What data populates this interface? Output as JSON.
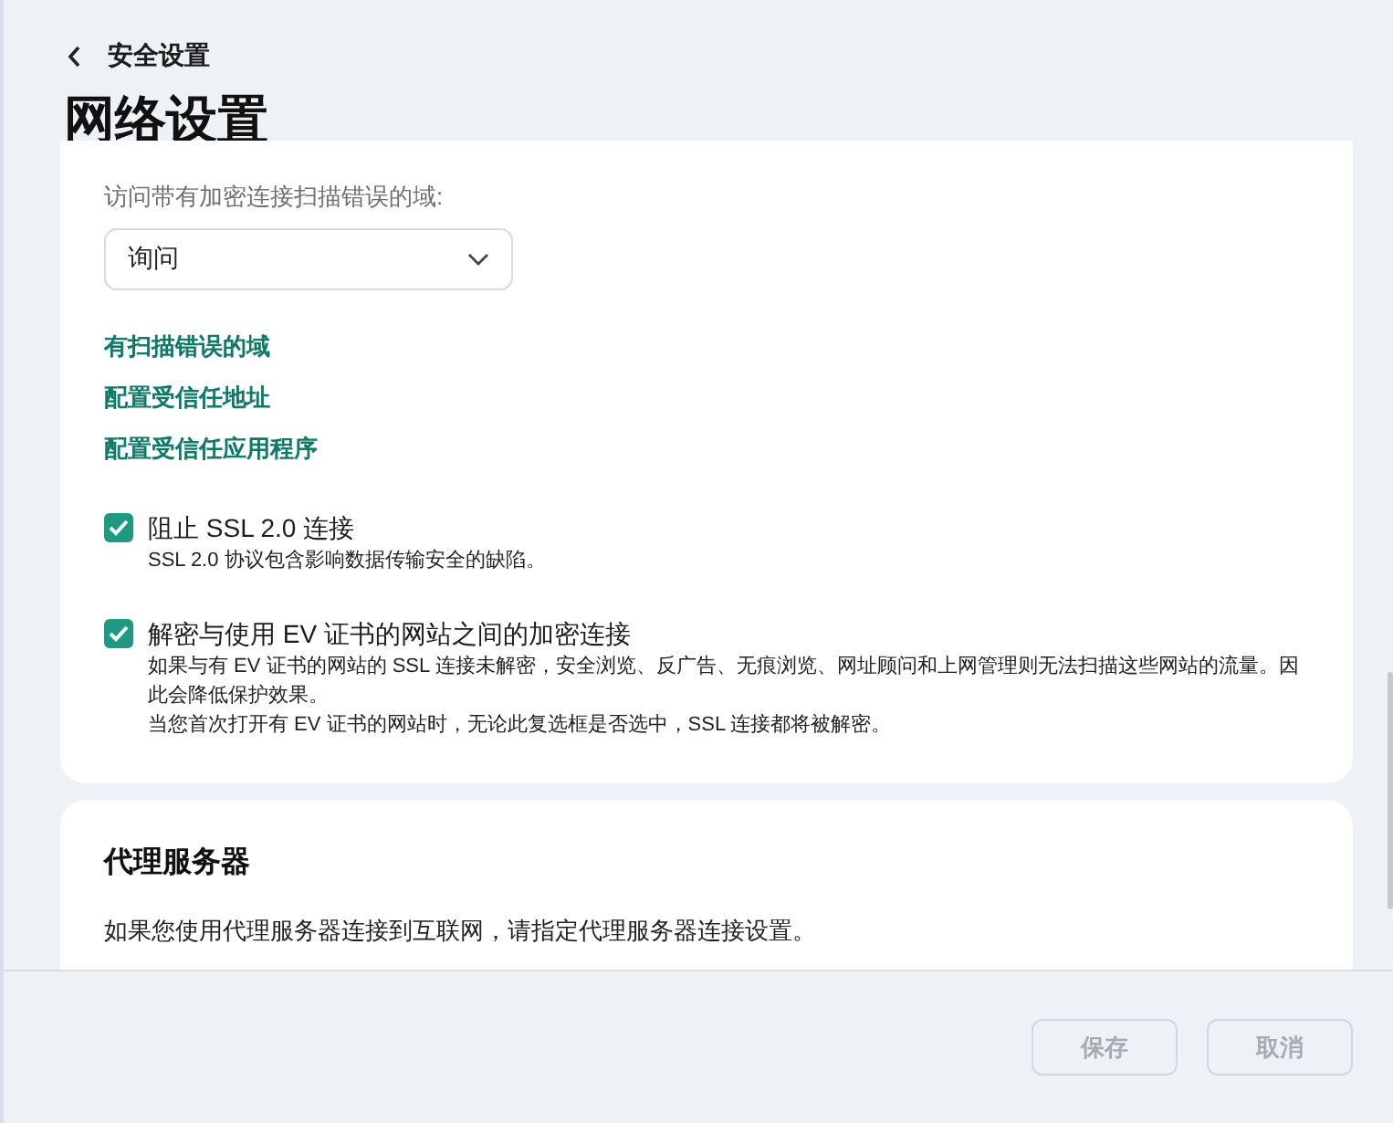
{
  "header": {
    "back": "安全设置",
    "title": "网络设置"
  },
  "encryption_card": {
    "domain_label": "访问带有加密连接扫描错误的域:",
    "domain_select": {
      "value": "询问"
    },
    "links": [
      "有扫描错误的域",
      "配置受信任地址",
      "配置受信任应用程序"
    ],
    "options": [
      {
        "label": "阻止 SSL 2.0 连接",
        "checked": true,
        "descriptions": [
          "SSL 2.0 协议包含影响数据传输安全的缺陷。"
        ]
      },
      {
        "label": "解密与使用 EV 证书的网站之间的加密连接",
        "checked": true,
        "descriptions": [
          "如果与有 EV 证书的网站的 SSL 连接未解密，安全浏览、反广告、无痕浏览、网址顾问和上网管理则无法扫描这些网站的流量。因此会降低保护效果。",
          "当您首次打开有 EV 证书的网站时，无论此复选框是否选中，SSL 连接都将被解密。"
        ]
      }
    ]
  },
  "proxy_card": {
    "title": "代理服务器",
    "description": "如果您使用代理服务器连接到互联网，请指定代理服务器连接设置。"
  },
  "footer": {
    "buttons": [
      {
        "label": "保存",
        "disabled": true
      },
      {
        "label": "取消",
        "disabled": true
      }
    ]
  }
}
